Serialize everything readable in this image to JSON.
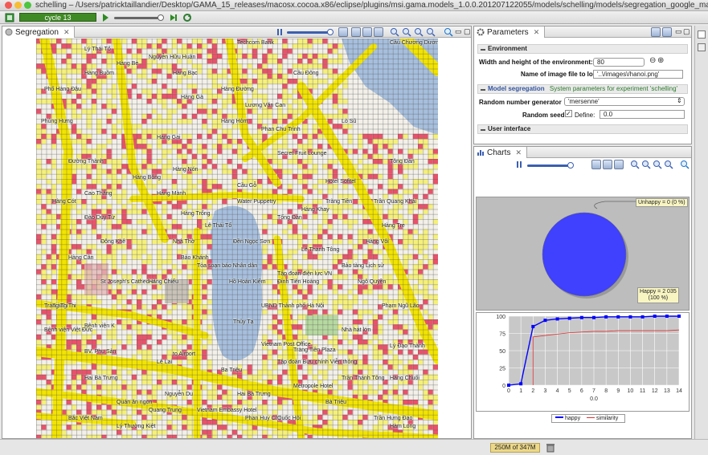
{
  "window": {
    "title": "schelling – /Users/patricktaillandier/Desktop/GAMA_15_releases/macosx.cocoa.x86/eclipse/plugins/msi.gama.models_1.0.0.201207122055/models/schelling/models/segregation_google_maps.gaml"
  },
  "toolbar": {
    "cycle_label": "cycle 13"
  },
  "segregation_view": {
    "tab_label": "Segregation",
    "map_labels": [
      "Techcom Bank",
      "Phùng Hưng",
      "Hàng Bè",
      "Hàng Bạc",
      "Hàng Đường",
      "Lương Văn Can",
      "Phan Chu Trinh",
      "Cầu Gỗ",
      "Hàng Gai",
      "Hàng Trống",
      "Nhà Thờ",
      "Lê Thái Tổ",
      "Hàng Khay",
      "Tràng Tiền",
      "Đinh Tiên Hoàng",
      "Hồ Hoàn Kiếm",
      "Đền Ngọc Sơn",
      "Thủy Tạ",
      "Bảo Khánh",
      "Hàng Bông",
      "Tràng Thi",
      "Bà Triệu",
      "Hai Bà Trưng",
      "Lý Thường Kiệt",
      "Quang Trung",
      "Bệnh viện K",
      "BV. Phụ Sản",
      "Tập đoàn điện lực VN",
      "UBND Thành phố Hà Nội",
      "Vietnam Post Office",
      "Tràng Tiền Plaza",
      "Hotel Sofitel",
      "Metropole Hotel",
      "Trần Quang Khải",
      "Ngô Quyền",
      "Nhà hát lớn",
      "Cầu Chương Dương",
      "Hàng Buồm",
      "Water Puppetry",
      "Tòa soạn báo Nhân dân",
      "St Joseph's Cathedral",
      "Phố Hàng Đậu",
      "Lý Thái Tổ",
      "Secret Fruit Lounge",
      "Hàng Gà",
      "Hàng Hòm",
      "Cầu Đông",
      "Đường Thành",
      "Hàng Cót",
      "Nguyễn Hữu Huân",
      "Lò Sũ",
      "Hàng Vôi",
      "Phạm Ngũ Lão",
      "Hàng Chuối",
      "Bảo tàng Lịch sử",
      "Bệnh viện Việt Đức",
      "Tràng Thi",
      "Trần Hưng Đạo",
      "Hàm Long",
      "Hai Bà Trưng",
      "Lê Lai",
      "Phan Huy Chú",
      "Quốc Hội",
      "Bắc Việt Nam",
      "Nguyễn Du",
      "Lý Đạo Thành",
      "Trần Thánh Tông",
      "Lê Thánh Tông",
      "Đông Khê",
      "Đào Duy Từ",
      "Tống Đản",
      "Hàng Tre",
      "Ba Triệu",
      "Tông Đản",
      "Tập đoàn Bưu chính Viễn thông",
      "Cao Thắng",
      "Hàng Mành",
      "Hàng Nón",
      "to Airport",
      "Vietnam Embassy Hotel",
      "Quán ăn ngon",
      "Hàng Cân",
      "Hàng Chiếu"
    ]
  },
  "parameters_view": {
    "tab_label": "Parameters",
    "sections": [
      {
        "title": "Environment"
      },
      {
        "title": "Model segregation",
        "subtitle": "System parameters for experiment 'schelling'"
      },
      {
        "title": "User interface"
      }
    ],
    "fields": [
      {
        "label": "Width and height of the environment:",
        "value": "80"
      },
      {
        "label": "Name of image file to load:",
        "value": "'..\\/images\\/hanoi.png'"
      },
      {
        "label": "Random number generator",
        "value": "'mersenne'"
      },
      {
        "label": "Random seed",
        "checkbox_label": "Define:",
        "value": "0.0"
      }
    ]
  },
  "charts_view": {
    "tab_label": "Charts",
    "pie_labels": {
      "unhappy": "Unhappy = 0 (0 %)",
      "happy_line1": "Happy = 2 035",
      "happy_line2": "(100 %)"
    },
    "line_axis_label": "0.0",
    "legend": [
      "happy",
      "similarity"
    ],
    "colors": {
      "happy": "#0000ff",
      "similarity": "#e03030",
      "pie": "#4040ff"
    }
  },
  "chart_data": [
    {
      "type": "pie",
      "categories": [
        "Unhappy",
        "Happy"
      ],
      "values": [
        0,
        2035
      ]
    },
    {
      "type": "line",
      "x": [
        0,
        1,
        2,
        3,
        4,
        5,
        6,
        7,
        8,
        9,
        10,
        11,
        12,
        13,
        14
      ],
      "series": [
        {
          "name": "happy",
          "values": [
            0,
            2,
            85,
            94,
            96,
            97,
            98,
            98,
            99,
            99,
            99,
            99,
            100,
            100,
            100
          ]
        },
        {
          "name": "similarity",
          "values": [
            null,
            null,
            70,
            72,
            74,
            76,
            77,
            78,
            78,
            79,
            79,
            79,
            79,
            79,
            80
          ]
        }
      ],
      "xlim": [
        0,
        14
      ],
      "ylim": [
        0,
        100
      ],
      "x_ticks": [
        "0",
        "1",
        "2",
        "3",
        "4",
        "5",
        "6",
        "7",
        "8",
        "9",
        "10",
        "11",
        "12",
        "13",
        "14"
      ],
      "y_ticks": [
        "0",
        "25",
        "50",
        "75",
        "100"
      ],
      "grid": true,
      "legend_position": "bottom"
    }
  ],
  "statusbar": {
    "memory": "250M of 347M"
  }
}
